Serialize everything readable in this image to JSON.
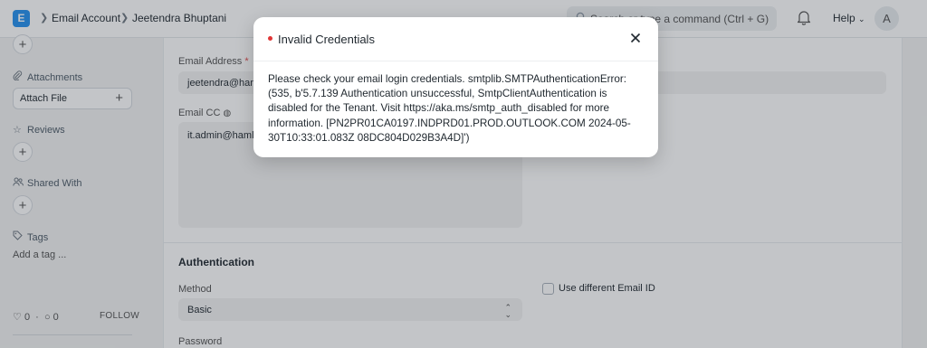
{
  "navbar": {
    "logo_letter": "E",
    "breadcrumbs": [
      "Email Account",
      "Jeetendra Bhuptani"
    ],
    "search_placeholder": "Search or type a command (Ctrl + G)",
    "help_label": "Help",
    "avatar_initial": "A"
  },
  "sidebar": {
    "attachments_label": "Attachments",
    "attach_file_label": "Attach File",
    "reviews_label": "Reviews",
    "shared_with_label": "Shared With",
    "tags_label": "Tags",
    "add_tag_label": "Add a tag ...",
    "likes_count": "0",
    "comments_count": "0",
    "follow_label": "FOLLOW"
  },
  "form": {
    "email_address_label": "Email Address",
    "email_address_value": "jeetendra@hamlab...",
    "email_cc_label": "Email CC",
    "email_cc_value": "it.admin@hamla...",
    "authentication_title": "Authentication",
    "method_label": "Method",
    "method_value": "Basic",
    "use_different_email_label": "Use different Email ID",
    "password_label": "Password"
  },
  "modal": {
    "title": "Invalid Credentials",
    "message": "Please check your email login credentials. smtplib.SMTPAuthenticationError: (535, b'5.7.139 Authentication unsuccessful, SmtpClientAuthentication is disabled for the Tenant. Visit https://aka.ms/smtp_auth_disabled for more information. [PN2PR01CA0197.INDPRD01.PROD.OUTLOOK.COM 2024-05-30T10:33:01.083Z 08DC804D029B3A4D]')"
  },
  "colors": {
    "accent": "#2490ef",
    "error_dot": "#e03636",
    "required": "#e24c4c"
  }
}
